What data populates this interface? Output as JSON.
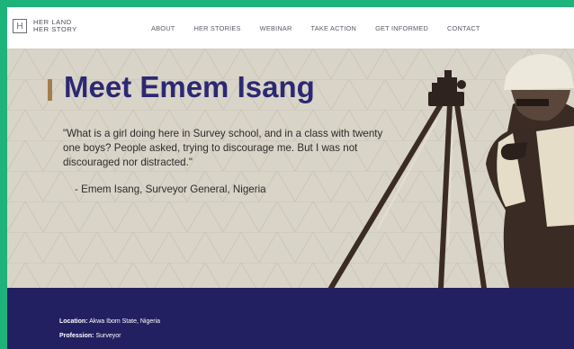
{
  "logo": {
    "mark": "H",
    "line1": "HER LAND",
    "line2": "HER STORY"
  },
  "nav": {
    "items": [
      "ABOUT",
      "HER STORIES",
      "WEBINAR",
      "TAKE ACTION",
      "GET INFORMED",
      "CONTACT"
    ]
  },
  "hero": {
    "title": "Meet Emem Isang",
    "quote": "\"What is a girl doing here in Survey school, and in a class with twenty one boys? People asked, trying to discourage me. But I was not discouraged nor distracted.\"",
    "attribution": "- Emem Isang, Surveyor General, Nigeria"
  },
  "details": {
    "location_label": "Location:",
    "location_value": "Akwa Ibom State, Nigeria",
    "profession_label": "Profession:",
    "profession_value": "Surveyor"
  },
  "colors": {
    "frame_accent": "#1db37a",
    "title": "#2c2873",
    "title_bar": "#a37d4d",
    "hero_bg": "#d9d4c8",
    "info_bg": "#232062"
  }
}
